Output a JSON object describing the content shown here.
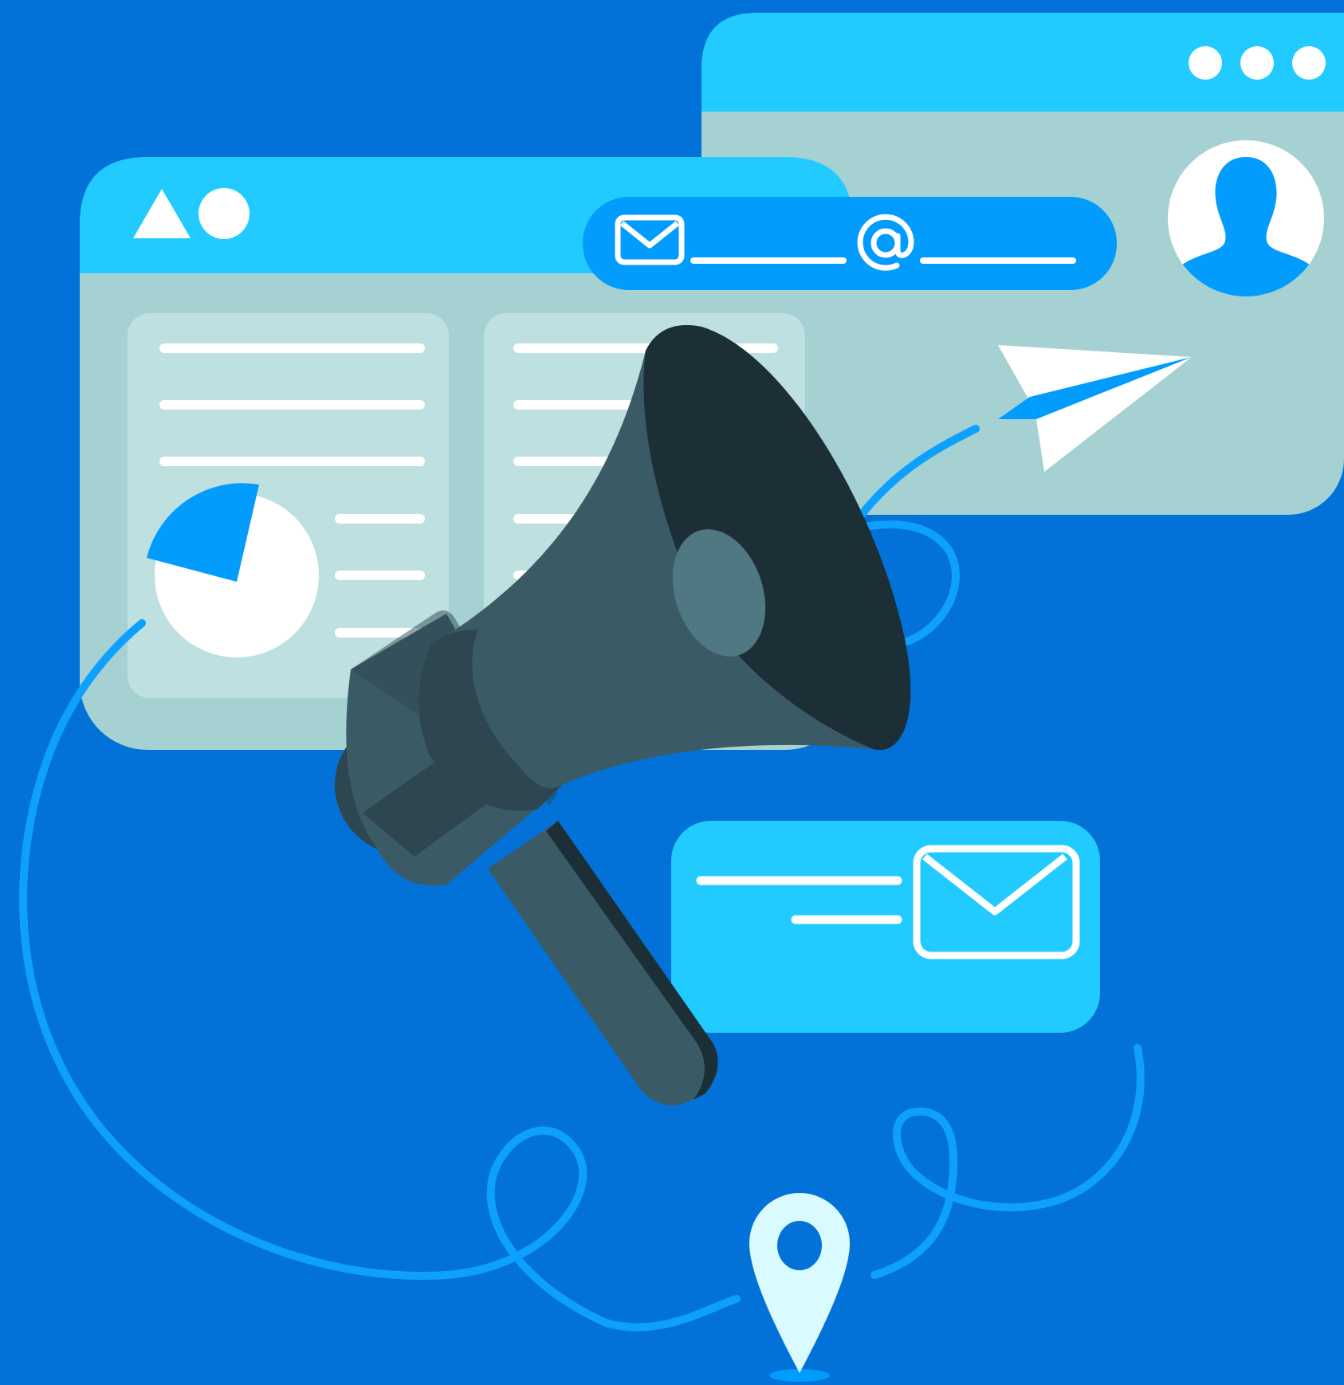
{
  "colors": {
    "background": "#0272d8",
    "window_titlebar": "#21cbff",
    "window_body": "#a5d1d2",
    "panel": "#bfe0e0",
    "accent_blue": "#019cfd",
    "white": "#ffffff",
    "megaphone_dark": "#1c2f37",
    "megaphone_mid": "#3a5b65",
    "megaphone_shade": "#2d4650",
    "megaphone_light": "#4f7883",
    "pin": "#d9fbff"
  },
  "icons": {
    "window_front_logo": [
      "triangle-icon",
      "circle-icon"
    ],
    "window_back_controls": "window-dots-icon",
    "avatar": "user-icon",
    "email_bar": [
      "envelope-icon",
      "at-sign-icon"
    ],
    "paper_plane": "paper-plane-icon",
    "pie": "pie-chart-icon",
    "message_card": "envelope-icon",
    "megaphone": "megaphone-icon",
    "location": "location-pin-icon"
  },
  "pie_chart": {
    "highlighted_fraction": 0.3
  }
}
